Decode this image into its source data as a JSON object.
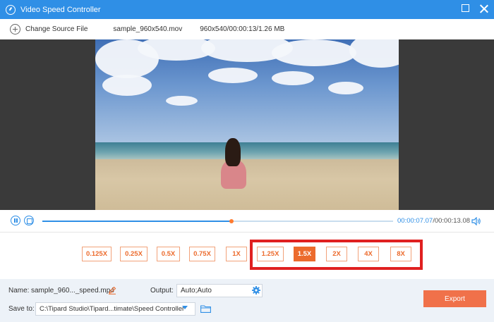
{
  "window": {
    "title": "Video Speed Controller",
    "controls": [
      "maximize-icon",
      "close-icon"
    ]
  },
  "toolbar": {
    "change_source_label": "Change Source File",
    "file_name": "sample_960x540.mov",
    "file_info": "960x540/00:00:13/1.26 MB"
  },
  "playback": {
    "progress_fraction": 0.54,
    "current_time": "00:00:07.07",
    "separator": "/",
    "total_time": "00:00:13.08"
  },
  "speeds": [
    {
      "label": "0.125X",
      "selected": false
    },
    {
      "label": "0.25X",
      "selected": false
    },
    {
      "label": "0.5X",
      "selected": false
    },
    {
      "label": "0.75X",
      "selected": false
    },
    {
      "label": "1X",
      "selected": false
    },
    {
      "label": "1.25X",
      "selected": false
    },
    {
      "label": "1.5X",
      "selected": true
    },
    {
      "label": "2X",
      "selected": false
    },
    {
      "label": "4X",
      "selected": false
    },
    {
      "label": "8X",
      "selected": false
    }
  ],
  "settings": {
    "name_label": "Name:",
    "name_value": "sample_960..._speed.mp4",
    "output_label": "Output:",
    "output_value": "Auto;Auto",
    "save_label": "Save to:",
    "save_value": "C:\\Tipard Studio\\Tipard...timate\\Speed Controller",
    "export_label": "Export"
  },
  "colors": {
    "accent": "#2f8fe6",
    "speed_orange": "#ec6b2d",
    "export": "#f0714a",
    "highlight_box": "#e02020"
  }
}
